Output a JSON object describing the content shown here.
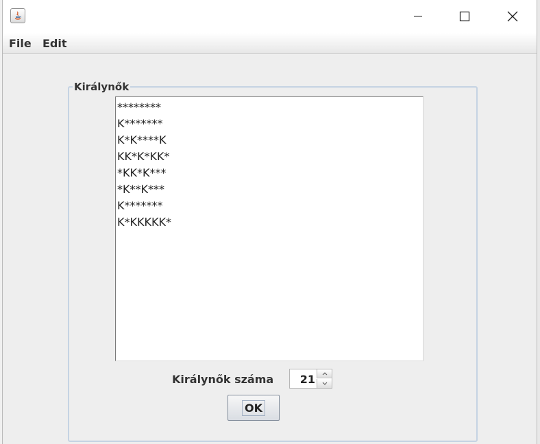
{
  "menu": {
    "file": "File",
    "edit": "Edit"
  },
  "panel": {
    "title": "Királynők",
    "lines": [
      "********",
      "K*******",
      "K*K****K",
      "KK*K*KK*",
      "*KK*K***",
      "*K**K***",
      "K*******",
      "K*KKKKK*"
    ]
  },
  "controls": {
    "count_label": "Királynők száma",
    "count_value": "21",
    "ok_label": "OK"
  },
  "icons": {
    "app": "java-icon",
    "minimize": "minimize-icon",
    "maximize": "maximize-icon",
    "close": "close-icon",
    "spin_up": "chevron-up-icon",
    "spin_down": "chevron-down-icon"
  }
}
